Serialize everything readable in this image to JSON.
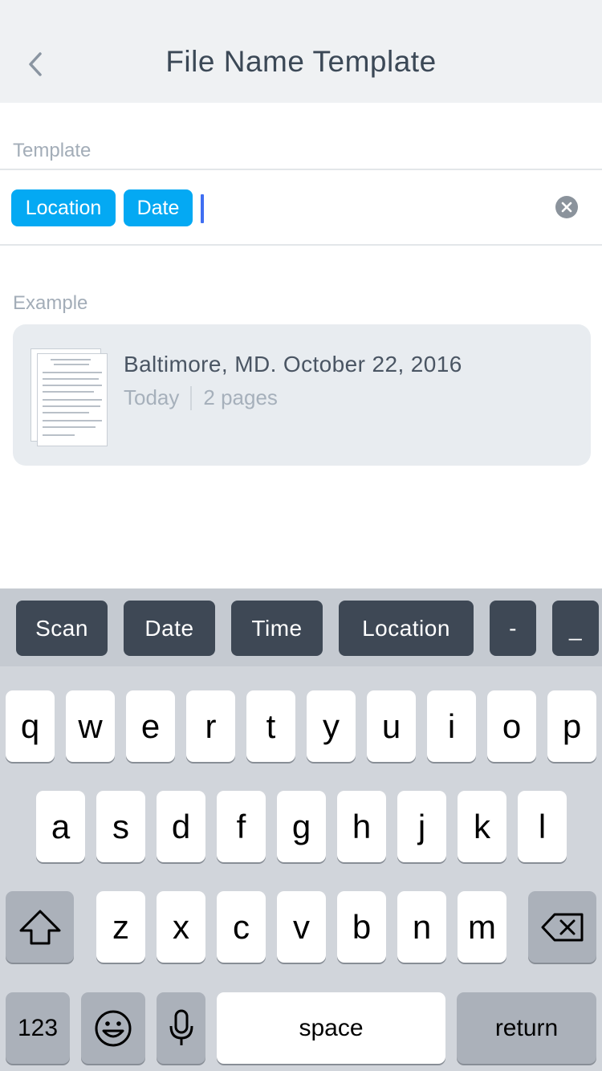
{
  "nav": {
    "title": "File Name Template",
    "back_icon": "chevron-left-icon"
  },
  "template_section": {
    "label": "Template",
    "tokens": [
      "Location",
      "Date"
    ],
    "clear_icon": "clear-circle-icon"
  },
  "example_section": {
    "label": "Example",
    "title": "Baltimore, MD. October 22, 2016",
    "date": "Today",
    "pages": "2 pages"
  },
  "suggestions": [
    "Scan",
    "Date",
    "Time",
    "Location",
    "-",
    "_"
  ],
  "keyboard": {
    "row1": [
      "q",
      "w",
      "e",
      "r",
      "t",
      "y",
      "u",
      "i",
      "o",
      "p"
    ],
    "row2": [
      "a",
      "s",
      "d",
      "f",
      "g",
      "h",
      "j",
      "k",
      "l"
    ],
    "row3": [
      "z",
      "x",
      "c",
      "v",
      "b",
      "n",
      "m"
    ],
    "numbers_label": "123",
    "space_label": "space",
    "return_label": "return",
    "shift_icon": "shift-icon",
    "delete_icon": "backspace-icon",
    "emoji_icon": "emoji-icon",
    "mic_icon": "microphone-icon"
  },
  "colors": {
    "token": "#04a9f3",
    "cursor": "#3f6ef2",
    "suggestion_key": "#3e4855",
    "nav_background": "#eff1f3",
    "card_background": "#e8ecf0"
  }
}
